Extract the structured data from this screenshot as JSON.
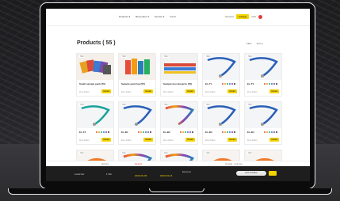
{
  "nav": {
    "items": [
      "Products ▾",
      "Besondere ▾",
      "Service ▾",
      "Info ▾"
    ]
  },
  "account": {
    "link_label": "Account",
    "button_label": "Anfrage",
    "cart_label": "Cart"
  },
  "page": {
    "title": "Products ( 55 )",
    "filter_label": "Filter",
    "sort_label": "Sort ▾"
  },
  "cards": [
    {
      "tag": "NEU",
      "title": "Small sample pack (55)",
      "sub": "Zum Artikel",
      "button": "Details",
      "thumb": "bags"
    },
    {
      "tag": "NEU",
      "title": "Sample pack big (55)",
      "sub": "Zum Artikel",
      "button": "Details",
      "thumb": "lanyards-pack"
    },
    {
      "tag": "NEU",
      "title": "Sample box lanyards (55)",
      "sub": "Zum Artikel",
      "button": "Details",
      "thumb": "lanyard-strip"
    },
    {
      "tag": "NEU",
      "title": "EL-T1",
      "sub": "Zum Artikel",
      "button": "Details",
      "thumb": "lanyard-blue"
    },
    {
      "tag": "NEU",
      "title": "EL-T2",
      "sub": "Zum Artikel",
      "button": "Details",
      "thumb": "lanyard-blue"
    },
    {
      "tag": "NEU",
      "title": "EL-T3",
      "sub": "Zum Artikel",
      "button": "Details",
      "thumb": "lanyard-teal"
    },
    {
      "tag": "NEU",
      "title": "EL-B1",
      "sub": "Zum Artikel",
      "button": "Details",
      "thumb": "lanyard-blue"
    },
    {
      "tag": "NEU",
      "title": "EL-B2",
      "sub": "Zum Artikel",
      "button": "Details",
      "thumb": "lanyard-rainbow"
    },
    {
      "tag": "NEU",
      "title": "EL-B3",
      "sub": "Zum Artikel",
      "button": "Details",
      "thumb": "lanyard-blue"
    },
    {
      "tag": "NEU",
      "title": "EL-B4",
      "sub": "Zum Artikel",
      "button": "Details",
      "thumb": "lanyard-blue"
    },
    {
      "tag": "NEU",
      "title": "",
      "sub": "",
      "button": "",
      "thumb": "lanyard-orange"
    },
    {
      "tag": "NEU",
      "title": "",
      "sub": "",
      "button": "",
      "thumb": "lanyard-rainbow"
    },
    {
      "tag": "NEU",
      "title": "",
      "sub": "",
      "button": "",
      "thumb": "lanyard-rainbow"
    },
    {
      "tag": "NEU",
      "title": "",
      "sub": "",
      "button": "",
      "thumb": "lanyard-orange"
    },
    {
      "tag": "NEU",
      "title": "",
      "sub": "",
      "button": "",
      "thumb": "lanyard-orange"
    }
  ],
  "footer": {
    "left": "Sprache",
    "mid": "Deutsch",
    "right": "Versand - Lieferzeit"
  },
  "bottombar": {
    "label1": "Lieferzeit",
    "label2": "1 Stk",
    "price1": "2023-03-09",
    "price2": "2023-03-14",
    "label3": "Express",
    "pill": "Jetzt bestellen",
    "colors": {
      "accent": "#f4d200",
      "dark": "#1e1e1e"
    }
  }
}
